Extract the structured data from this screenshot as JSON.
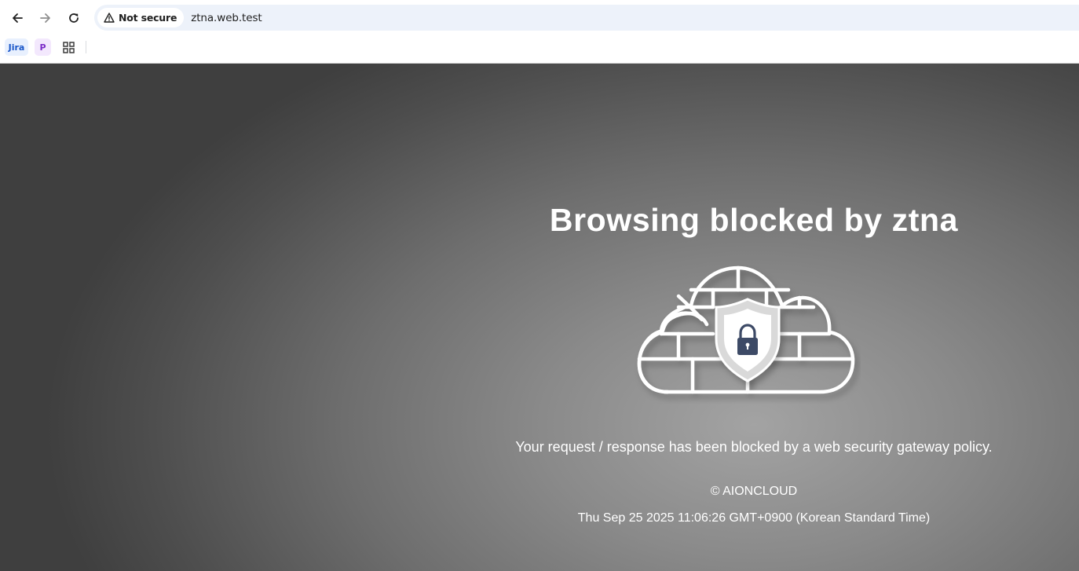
{
  "browser": {
    "security_chip_label": "Not secure",
    "url": "ztna.web.test",
    "icons": {
      "back": "arrow-left-icon",
      "forward": "arrow-right-icon",
      "reload": "reload-icon",
      "security": "warning-triangle-icon",
      "apps": "apps-grid-icon"
    },
    "bookmarks": [
      {
        "label": "Jira"
      },
      {
        "label": "P"
      }
    ]
  },
  "page": {
    "title": "Browsing blocked by ztna",
    "message": "Your request / response has been blocked by a web security gateway policy.",
    "copyright": "© AIONCLOUD",
    "timestamp": "Thu Sep 25 2025 11:06:26 GMT+0900 (Korean Standard Time)"
  },
  "colors": {
    "accent_lock": "#3d4a66",
    "shield": "#d9d9d9",
    "text": "#ffffff"
  }
}
